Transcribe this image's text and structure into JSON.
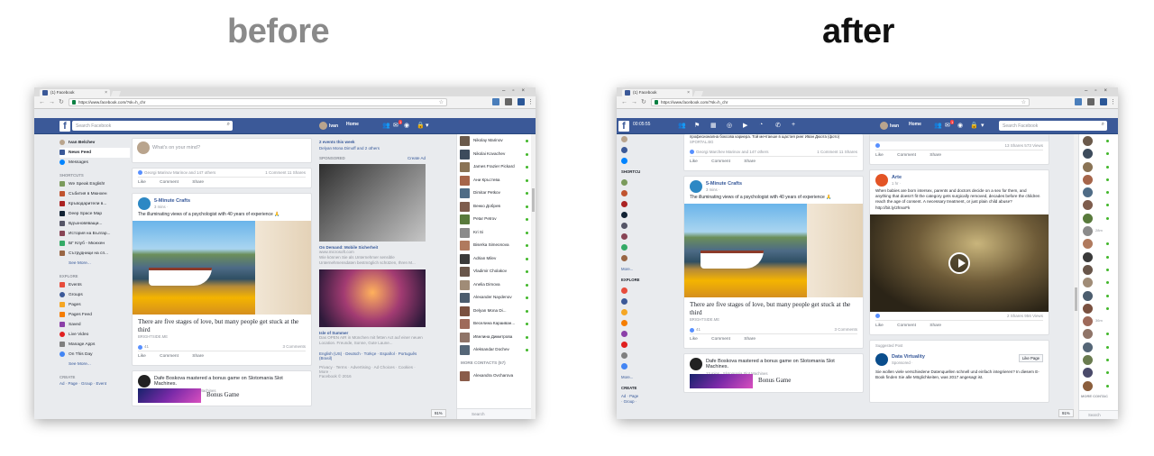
{
  "headings": {
    "before": "before",
    "after": "after"
  },
  "browser": {
    "tab_title": "(1) Facebook",
    "url": "https://www.facebook.com/?sk=h_chr"
  },
  "before": {
    "search_placeholder": "Search Facebook",
    "user": "Ivan",
    "home": "Home",
    "left_nav": {
      "profile": "Ivan Belchev",
      "items": [
        "News Feed",
        "Messages"
      ],
      "shortcuts_heading": "SHORTCUTS",
      "shortcuts": [
        "We Speak English!",
        "Събития в Мюнхен",
        "Кръводарители в...",
        "Deep Space Map",
        "Вдъхновяващи...",
        "История на Българ...",
        "БГ Клуб - Мюнхен",
        "Сътрудници на сп..."
      ],
      "see_more_1": "See More...",
      "explore_heading": "EXPLORE",
      "explore": [
        "Events",
        "Groups",
        "Pages",
        "Pages Feed",
        "Saved",
        "Live Video",
        "Manage Apps",
        "On This Day"
      ],
      "see_more_2": "See More...",
      "create_heading": "CREATE",
      "create_links": "Ad · Page · Group · Event"
    },
    "composer": {
      "placeholder": "What's on your mind?"
    },
    "post1": {
      "reactions": "Georgi Marinov Marinov and 147 others",
      "stats": "1 Comment  11 Shares",
      "actions": "Like Comment Share"
    },
    "post2": {
      "page": "5-Minute Crafts",
      "time": "3 mins · ",
      "text": "The illuminating views of a psychologist with 40 years of experience 🙏",
      "headline": "There are five stages of love, but many people get stuck at the third",
      "domain": "BRIGHTSIDE.ME",
      "reaction_count": "41",
      "comments": "3 Comments",
      "actions": "Like Comment Share"
    },
    "post3": {
      "text": "Dafe Boskova mastered a bonus game on Slotomania Slot Machines.",
      "time": "13 mins · Slotomania Slot Machines",
      "game": "Bonus Game"
    },
    "right_col": {
      "events": "2 events this week",
      "events_sub": "Delyan Mona Dimoff and 2 others",
      "sponsored": "SPONSORED",
      "create_ad": "Create Ad",
      "ad1_title": "On Demand: Mobile Sicherheit",
      "ad1_url": "www.microsoft.com",
      "ad1_desc": "Wie können Sie als Unternehmer sensible Unternehmensdaten bestmöglich schützen, Ihren M...",
      "ad2_title": "Isle of Summer",
      "ad2_desc": "Das OPEN AIR in München mit fetten Act auf einer neuen Location. Freunde, Sonne, Gute Laune...",
      "languages": "English (US) · Deutsch · Türkçe · Español · Português (Brasil)",
      "footer": "Privacy · Terms · Advertising · Ad Choices · Cookies · More ·",
      "copyright": "Facebook © 2016"
    },
    "chat": [
      "Nikolay Marinov",
      "Nikolai Kovachev",
      "James Frazier Pickard",
      "Ани Кръстева",
      "Dimitar Petkov",
      "Венко Добрев",
      "Petar Petrov",
      "Kri Si",
      "Biserka Simeonova",
      "Adrian Milev",
      "Vladimir Cholakov",
      "Anelia Dimova",
      "Alexander Naydenov",
      "Delyan Mona Di...",
      "Веселина Караиван...",
      "Ивелина Димитрова",
      "Aleksandar Dochev"
    ],
    "more_contacts": "MORE CONTACTS (57)",
    "last_contact": "Alexandra Ovcharova",
    "chat_search": "Search",
    "zoom": "91%"
  },
  "after": {
    "time": "00:05:55",
    "user": "Ivan",
    "home": "Home",
    "search_placeholder": "Search Facebook",
    "left_rail": {
      "shortcuts": "SHORTCUTS",
      "explore": "EXPLORE",
      "more1": "More...",
      "more2": "More...",
      "create": "CREATE",
      "create_links": "Ad · Page · Group · Event"
    },
    "top_snippet": {
      "text": "професионална боксова кариера. Той мечтаеше в щастия ринг Иван Дюота (фото)",
      "domain": "SPORTAL.BG"
    },
    "post1": {
      "reactions": "Georgi Marchev Marinov and 147 others",
      "stats": "1 Comment  11 Shares",
      "actions": "Like Comment Share"
    },
    "post2": {
      "page": "5-Minute Crafts",
      "time": "3 mins · ",
      "text": "The illuminating views of a psychologist with 40 years of experience 🙏",
      "headline": "There are five stages of love, but many people get stuck at the third",
      "domain": "BRIGHTSIDE.ME",
      "reaction_count": "41",
      "comments": "3 Comments",
      "actions": "Like Comment Share"
    },
    "post3": {
      "text": "Dafe Boskova mastered a bonus game on Slotomania Slot Machines.",
      "time": "13 mins · Slotomania Slot Machines",
      "game": "Bonus Game"
    },
    "col2_top": {
      "stats": "13 Shares  573 Views",
      "actions": "Like Comment Share"
    },
    "arte": {
      "name": "Arte",
      "time": "1 hr · ",
      "text": "When babies are born intersex, parents and doctors decide on a sex for them, and anything that doesn't fit the category gets surgically removed, decades before the children reach the age of consent. A necessary treatment, or just plain child abuse? http://bit.ly/2hIxxFk",
      "stats": "2 Shares  956 Views",
      "actions": "Like Comment Share"
    },
    "suggested": {
      "label": "Suggested Post",
      "page": "Data Virtuality",
      "sponsored": "Sponsored · ",
      "like_page": "Like Page",
      "text": "Sie wollen viele verschiedene Datenquellen schnell und einfach integrieren? In diesem E-Book finden Sie alle Möglichkeiten, was 2017 angesagt ist."
    },
    "chat_labels": [
      "28m",
      "36m"
    ],
    "more_contacts": "MORE CONTAC",
    "chat_search": "Search",
    "zoom": "91%"
  },
  "colors": {
    "facebook_blue": "#3b5998",
    "link": "#365899",
    "online": "#42b72a",
    "page_bg": "#e9ebee"
  }
}
